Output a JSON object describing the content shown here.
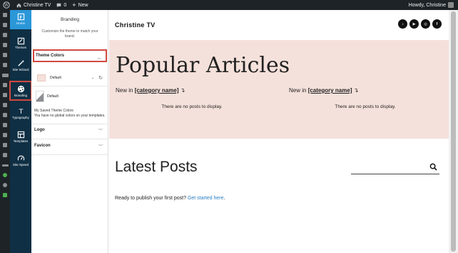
{
  "adminbar": {
    "site_name": "Christine TV",
    "comments_count": "0",
    "new_label": "New",
    "greeting": "Howdy, Christine"
  },
  "tools": [
    {
      "label": "Home",
      "icon": "home-icon"
    },
    {
      "label": "Themes",
      "icon": "themes-icon"
    },
    {
      "label": "Site Wizard",
      "icon": "wand-icon"
    },
    {
      "label": "Branding",
      "icon": "palette-icon"
    },
    {
      "label": "Typography",
      "icon": "typography-icon"
    },
    {
      "label": "Templates",
      "icon": "templates-icon"
    },
    {
      "label": "Site Speed",
      "icon": "speedometer-icon"
    }
  ],
  "panel": {
    "title": "Branding",
    "description": "Customize the theme to match your brand.",
    "theme_colors_label": "Theme Colors",
    "selected_palette": "Default",
    "default_tile_label": "Default",
    "saved_title": "My Saved Theme Colors",
    "saved_empty": "You have no global colors on your templates.",
    "logo_label": "Logo",
    "favicon_label": "Favicon"
  },
  "preview": {
    "site_title": "Christine TV",
    "social_icons": [
      "tiktok-icon",
      "youtube-icon",
      "instagram-icon",
      "facebook-icon"
    ],
    "popular_title": "Popular Articles",
    "new_in_label": "New in",
    "category_placeholder": "[category name]",
    "arrow": "↴",
    "no_posts": "There are no posts to display.",
    "latest_title": "Latest Posts",
    "ready_text": "Ready to publish your first post?",
    "get_started_link": "Get started here",
    "period": "."
  },
  "colors": {
    "admin_dark": "#1d2327",
    "rail_navy": "#0f2f44",
    "active_blue": "#2b97d9",
    "highlight_red": "#d1493f",
    "pink_bg": "#f5e1db",
    "link_blue": "#2a7ec1"
  }
}
